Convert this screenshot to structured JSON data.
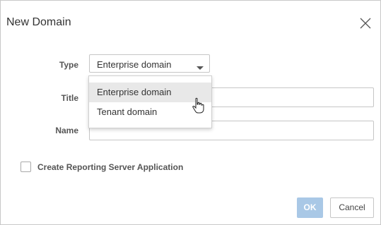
{
  "dialog": {
    "title": "New Domain",
    "close_icon": "close-icon"
  },
  "form": {
    "type_label": "Type",
    "type_value": "Enterprise domain",
    "title_label": "Title",
    "title_value": "",
    "name_label": "Name",
    "name_value": ""
  },
  "type_dropdown": {
    "options": [
      "Enterprise domain",
      "Tenant domain"
    ],
    "highlighted": "Enterprise domain"
  },
  "checkbox": {
    "label": "Create Reporting Server Application",
    "checked": false
  },
  "footer": {
    "ok_label": "OK",
    "cancel_label": "Cancel"
  },
  "colors": {
    "ok_button": "#a9c8e6",
    "highlight": "#e8e8e8"
  }
}
